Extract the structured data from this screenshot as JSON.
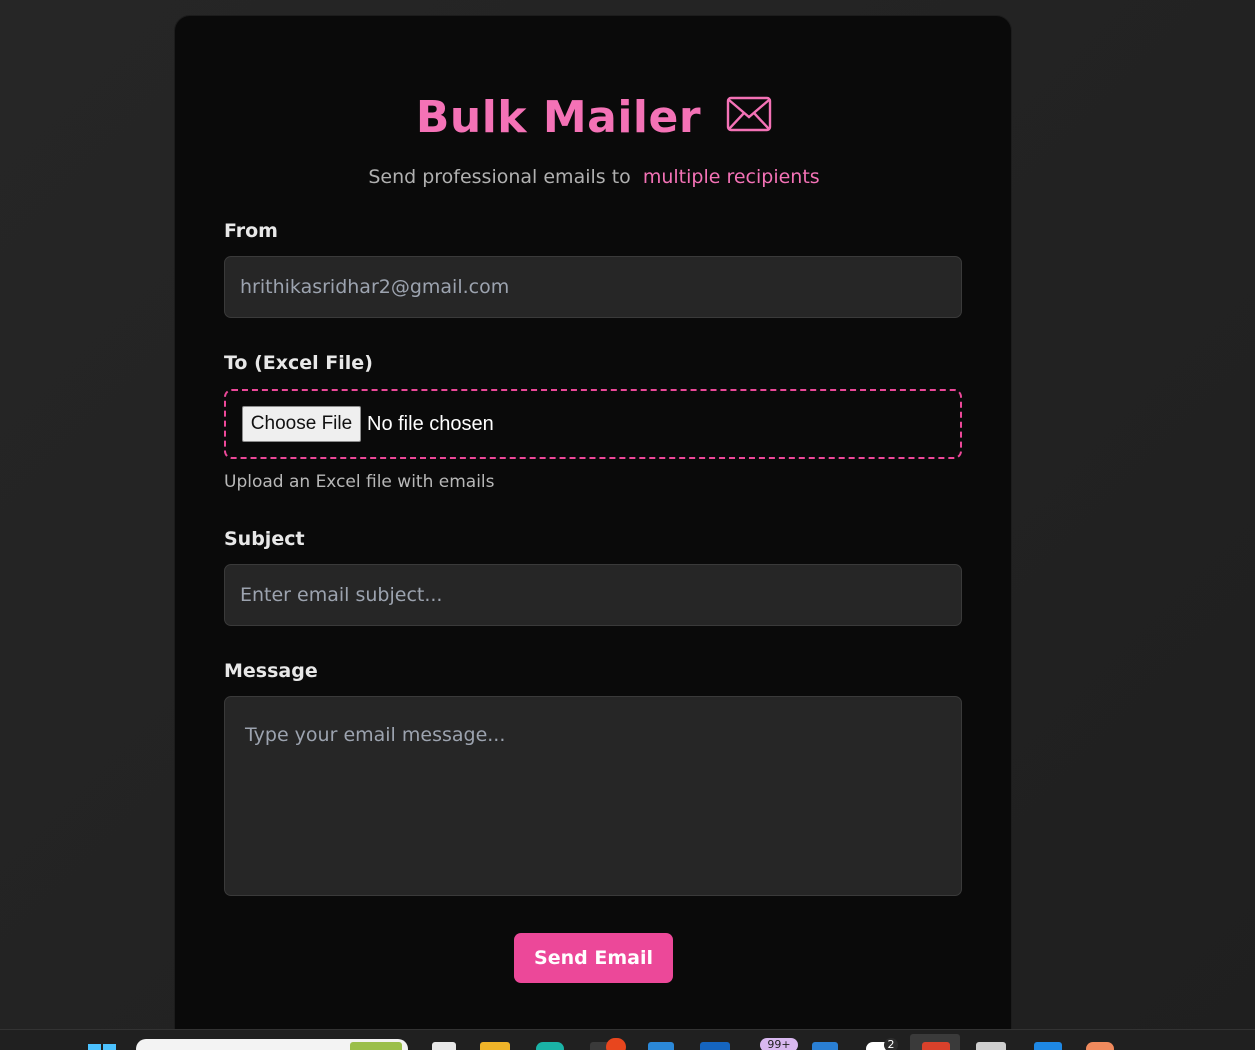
{
  "header": {
    "title": "Bulk Mailer",
    "title_icon": "envelope-icon",
    "subtitle_prefix": "Send professional emails to",
    "subtitle_accent": "multiple recipients"
  },
  "form": {
    "from": {
      "label": "From",
      "value": "hrithikasridhar2@gmail.com"
    },
    "to": {
      "label": "To (Excel File)",
      "choose_button": "Choose File",
      "file_status": "No file chosen",
      "hint": "Upload an Excel file with emails"
    },
    "subject": {
      "label": "Subject",
      "placeholder": "Enter email subject..."
    },
    "message": {
      "label": "Message",
      "placeholder": "Type your email message..."
    },
    "submit_label": "Send Email"
  },
  "colors": {
    "accent": "#f472b6",
    "button": "#ec4899",
    "card_background": "#0a0a0a",
    "input_background": "#262626"
  },
  "taskbar": {
    "badge_mail": "99+",
    "badge_count": "2"
  }
}
